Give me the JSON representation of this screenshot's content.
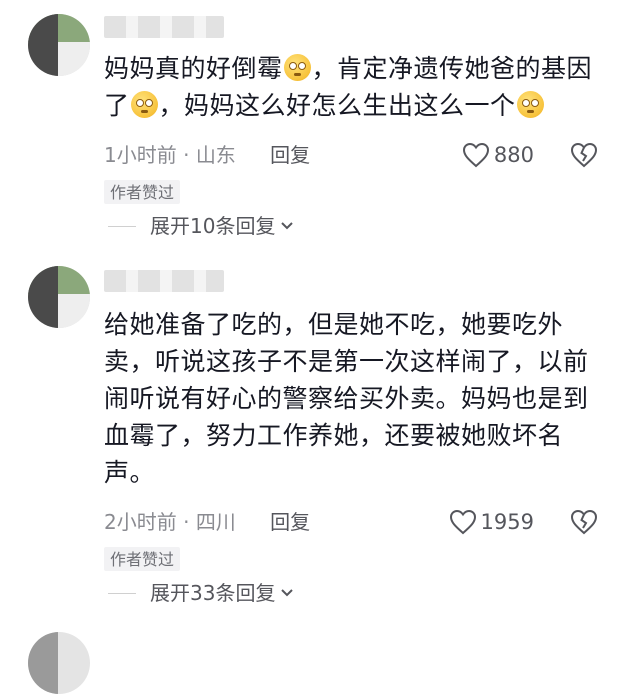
{
  "comments": [
    {
      "text_parts": [
        "妈妈真的好倒霉",
        "，肯定净遗传她爸的基因了",
        "，妈妈这么好怎么生出这么一个"
      ],
      "emoji": "flushed-face",
      "time": "1小时前",
      "location": "山东",
      "reply_label": "回复",
      "likes": "880",
      "badge": "作者赞过",
      "expand_label": "展开10条回复"
    },
    {
      "text": "给她准备了吃的，但是她不吃，她要吃外卖，听说这孩子不是第一次这样闹了，以前闹听说有好心的警察给买外卖。妈妈也是到血霉了，努力工作养她，还要被她败坏名声。",
      "time": "2小时前",
      "location": "四川",
      "reply_label": "回复",
      "likes": "1959",
      "badge": "作者赞过",
      "expand_label": "展开33条回复"
    }
  ],
  "meta_separator": "·",
  "icons": {
    "like": "heart-outline-icon",
    "dislike": "broken-heart-icon",
    "expand": "chevron-down-icon"
  },
  "colors": {
    "text": "#161823",
    "meta": "#8a8b91",
    "badge_bg": "#f2f2f4",
    "emoji": "#f7c23b"
  }
}
